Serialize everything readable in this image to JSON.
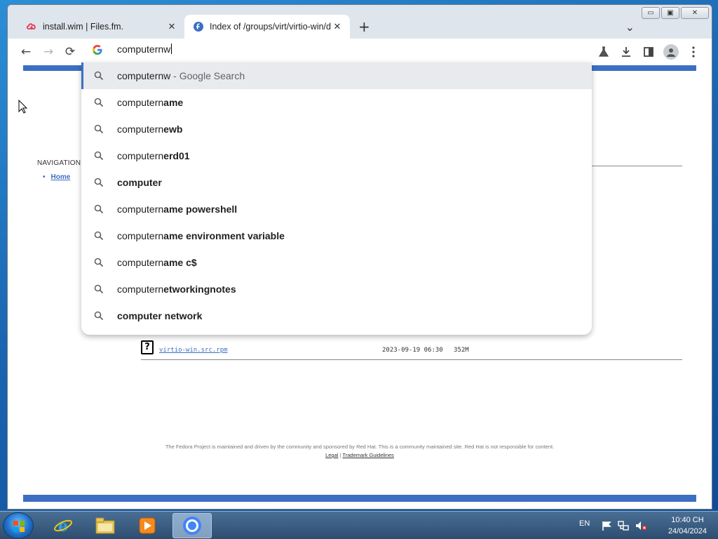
{
  "browser": {
    "tabs": [
      {
        "title": "install.wim | Files.fm.",
        "favicon": "filesfm-cloud-icon",
        "active": false
      },
      {
        "title": "Index of /groups/virt/virtio-win/d",
        "favicon": "fedora-icon",
        "active": true
      }
    ],
    "new_tab_symbol": "+",
    "tab_list_symbol": "⌄",
    "window_controls": {
      "minimize": "▭",
      "maximize": "▣",
      "close": "✕"
    },
    "nav": {
      "back": "←",
      "forward": "→",
      "reload": "⟳"
    }
  },
  "omnibox": {
    "value": "computernw"
  },
  "suggestions": [
    {
      "typed": "computernw",
      "bold": "",
      "suffix": " - Google Search",
      "selected": true
    },
    {
      "typed": "computern",
      "bold": "ame",
      "suffix": ""
    },
    {
      "typed": "computern",
      "bold": "ewb",
      "suffix": ""
    },
    {
      "typed": "computern",
      "bold": "erd01",
      "suffix": ""
    },
    {
      "typed": "",
      "bold": "computer",
      "suffix": ""
    },
    {
      "typed": "computern",
      "bold": "ame powershell",
      "suffix": ""
    },
    {
      "typed": "computern",
      "bold": "ame environment variable",
      "suffix": ""
    },
    {
      "typed": "computern",
      "bold": "ame c$",
      "suffix": ""
    },
    {
      "typed": "computern",
      "bold": "etworkingnotes",
      "suffix": ""
    },
    {
      "typed": "",
      "bold": "computer network",
      "suffix": ""
    }
  ],
  "page": {
    "navigation_heading": "NAVIGATION",
    "home_link": "Home",
    "file_entry": {
      "name": "virtio-win.src.rpm",
      "date": "2023-09-19 06:30",
      "size": "352M",
      "icon": "unknown-file-icon"
    },
    "footer_text": "The Fedora Project is maintained and driven by the community and sponsored by Red Hat. This is a community maintained site. Red Hat is not responsible for content.",
    "footer_links": [
      "Legal",
      "Trademark Guidelines"
    ],
    "footer_separator": "|",
    "accent_color": "#3c6fc3"
  },
  "taskbar": {
    "items": [
      "internet-explorer-icon",
      "file-explorer-icon",
      "media-player-icon",
      "chrome-icon"
    ],
    "active_item": "chrome-icon",
    "language": "EN",
    "time": "10:40 CH",
    "date": "24/04/2024"
  }
}
